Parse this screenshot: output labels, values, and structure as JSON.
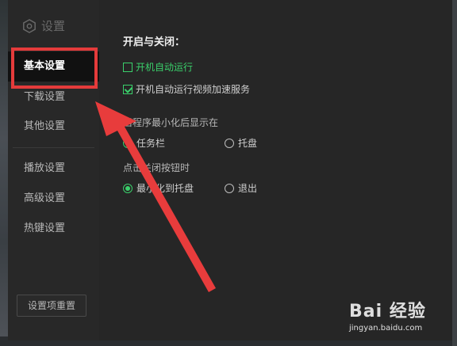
{
  "sidebar": {
    "brand": "设置",
    "items": [
      {
        "label": "基本设置",
        "active": true
      },
      {
        "label": "下载设置"
      },
      {
        "label": "其他设置"
      },
      {
        "label": "播放设置"
      },
      {
        "label": "高级设置"
      },
      {
        "label": "热键设置"
      }
    ],
    "reset_label": "设置项重置"
  },
  "window": {
    "close_symbol": "✕"
  },
  "content": {
    "section_title": "开启与关闭：",
    "checkboxes": [
      {
        "label": "开机自动运行",
        "checked": false
      },
      {
        "label": "开机自动运行视频加速服务",
        "checked": true
      }
    ],
    "minimize_group": {
      "label": "当程序最小化后显示在",
      "options": [
        {
          "label": "任务栏",
          "selected": true
        },
        {
          "label": "托盘",
          "selected": false
        }
      ]
    },
    "close_group": {
      "label": "点击关闭按钮时",
      "options": [
        {
          "label": "最小化到托盘",
          "selected": true
        },
        {
          "label": "退出",
          "selected": false
        }
      ]
    }
  },
  "watermark": {
    "logo": "Bai 经验",
    "url": "jingyan.baidu.com"
  },
  "colors": {
    "accent_green": "#3ad06b",
    "highlight_red": "#e43b3b"
  },
  "icons": {
    "brand": "settings-hex-icon",
    "close": "close-icon"
  }
}
